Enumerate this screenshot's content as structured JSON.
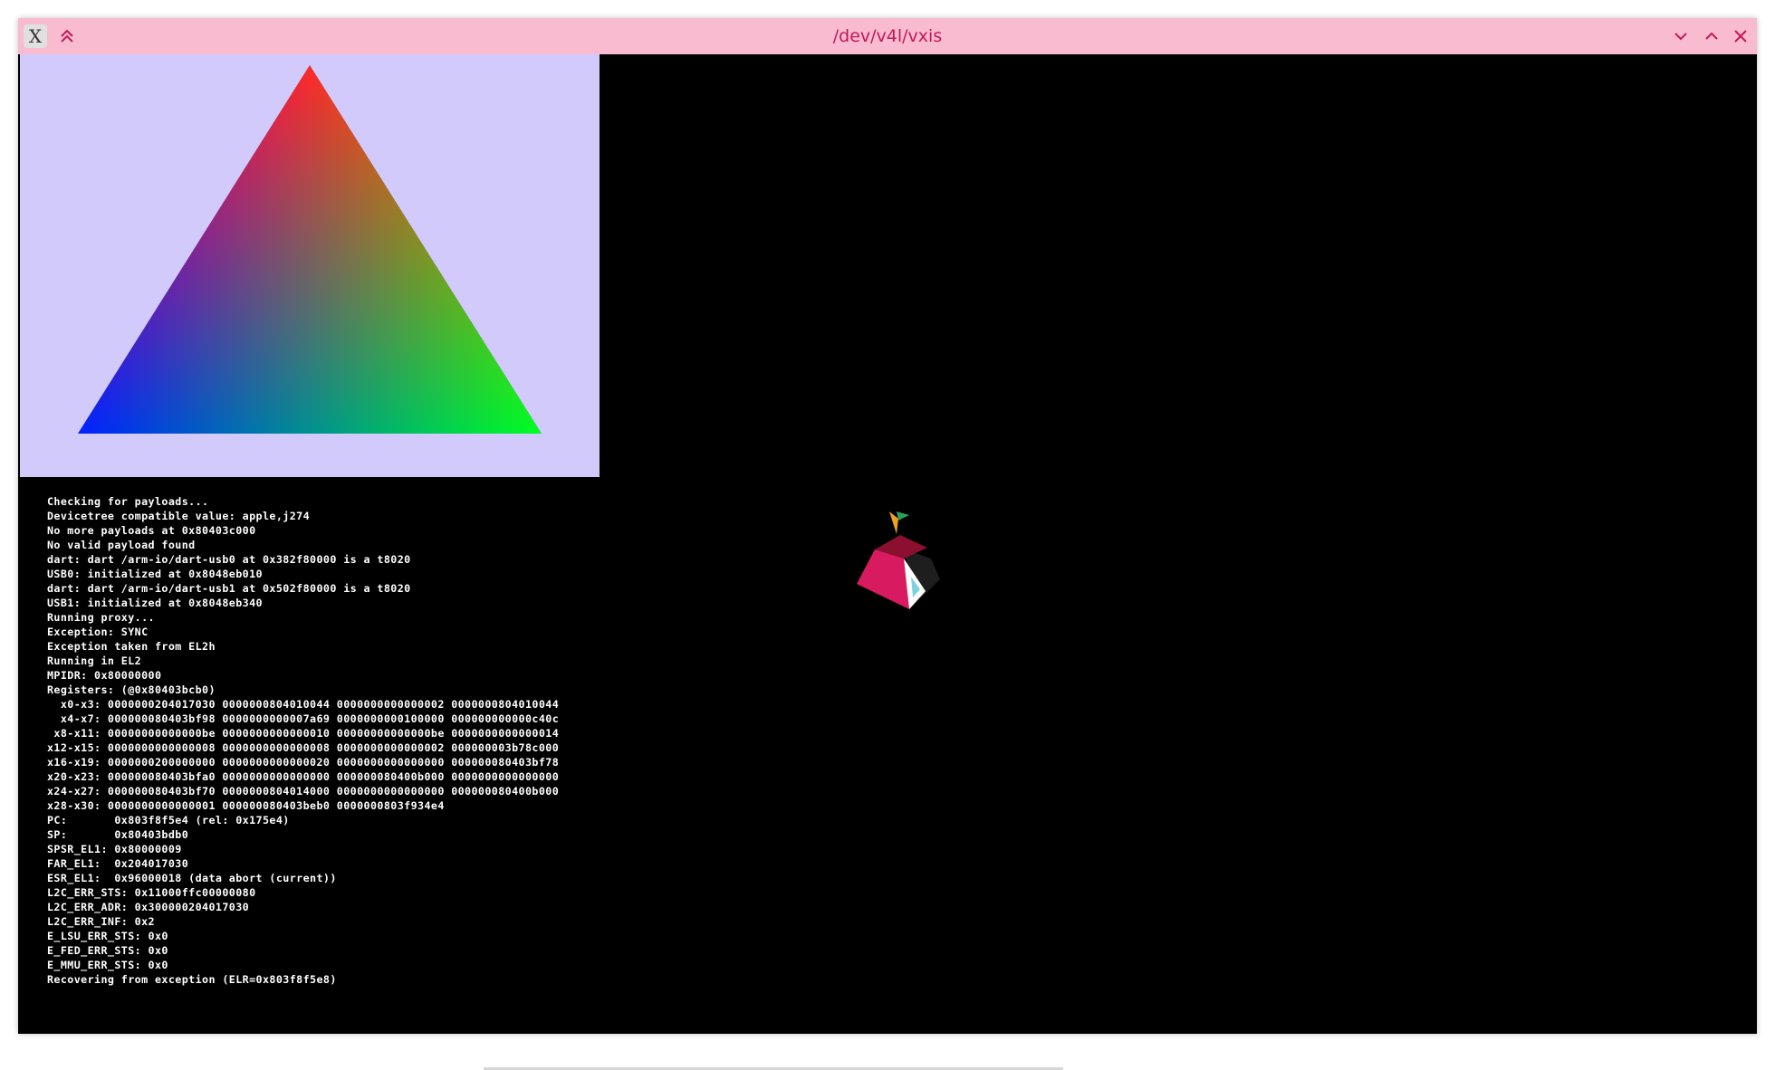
{
  "window": {
    "title": "/dev/v4l/vxis",
    "app_icon_glyph": "X",
    "titlebar_color": "#f8bbd0",
    "title_color": "#c2185b",
    "buttons": {
      "keep_above": "double-chevron-up-icon",
      "minimize": "chevron-down-icon",
      "maximize": "chevron-up-icon",
      "close": "close-icon"
    }
  },
  "gl_panel": {
    "background": "#d3cafc",
    "triangle_colors": {
      "top": "#ff0000",
      "bottom_left": "#0000ff",
      "bottom_right": "#00ff00"
    }
  },
  "console": {
    "lines": [
      "Checking for payloads...",
      "Devicetree compatible value: apple,j274",
      "No more payloads at 0x80403c000",
      "No valid payload found",
      "dart: dart /arm-io/dart-usb0 at 0x382f80000 is a t8020",
      "USB0: initialized at 0x8048eb010",
      "dart: dart /arm-io/dart-usb1 at 0x502f80000 is a t8020",
      "USB1: initialized at 0x8048eb340",
      "Running proxy...",
      "Exception: SYNC",
      "Exception taken from EL2h",
      "Running in EL2",
      "MPIDR: 0x80000000",
      "Registers: (@0x80403bcb0)",
      "  x0-x3: 0000000204017030 0000000804010044 0000000000000002 0000000804010044",
      "  x4-x7: 000000080403bf98 0000000000007a69 0000000000100000 000000000000c40c",
      " x8-x11: 00000000000000be 0000000000000010 00000000000000be 0000000000000014",
      "x12-x15: 0000000000000008 0000000000000008 0000000000000002 000000003b78c000",
      "x16-x19: 0000000200000000 0000000000000020 0000000000000000 000000080403bf78",
      "x20-x23: 000000080403bfa0 0000000000000000 000000080400b000 0000000000000000",
      "x24-x27: 000000080403bf70 0000000804014000 0000000000000000 000000080400b000",
      "x28-x30: 0000000000000001 000000080403beb0 0000000803f934e4",
      "PC:       0x803f8f5e4 (rel: 0x175e4)",
      "SP:       0x80403bdb0",
      "SPSR_EL1: 0x80000009",
      "FAR_EL1:  0x204017030",
      "ESR_EL1:  0x96000018 (data abort (current))",
      "L2C_ERR_STS: 0x11000ffc00000080",
      "L2C_ERR_ADR: 0x300000204017030",
      "L2C_ERR_INF: 0x2",
      "E_LSU_ERR_STS: 0x0",
      "E_FED_ERR_STS: 0x0",
      "E_MMU_ERR_STS: 0x0",
      "Recovering from exception (ELR=0x803f8f5e8)"
    ]
  },
  "logo": {
    "icon": "asahi-linux-logo-icon",
    "colors": {
      "body": "#d81b60",
      "top": "#8b0f2f",
      "dark": "#1e1e1e",
      "arrow": "#ffffff",
      "arrow_accent": "#7fd3e0",
      "leaf": "#2e9e5e",
      "stem": "#f0a020"
    }
  }
}
